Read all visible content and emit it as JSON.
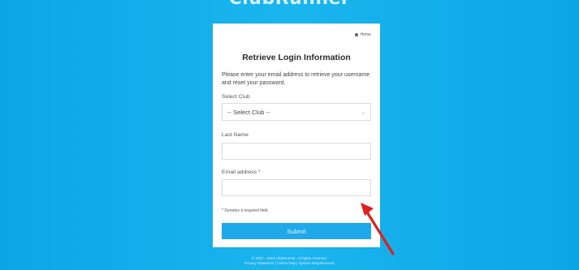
{
  "brand": "ClubRunner",
  "card": {
    "home_link": "Home",
    "title": "Retrieve Login Information",
    "description": "Please enter your email address to retrieve your username and reset your password.",
    "club_label": "Select Club",
    "club_selected": "-- Select Club --",
    "last_name_label": "Last Name",
    "last_name_value": "",
    "email_label": "Email address *",
    "email_value": "",
    "required_note": "* Denotes a required field.",
    "submit_label": "Submit"
  },
  "footer": {
    "copyright": "© 2002 - 2015 ClubRunner. All rights reserved.",
    "links": "Privacy Statement | Online help | System Requirements"
  },
  "colors": {
    "background": "#0aa6e6",
    "button": "#1fa9e8",
    "annotation_arrow": "#e0201b"
  }
}
